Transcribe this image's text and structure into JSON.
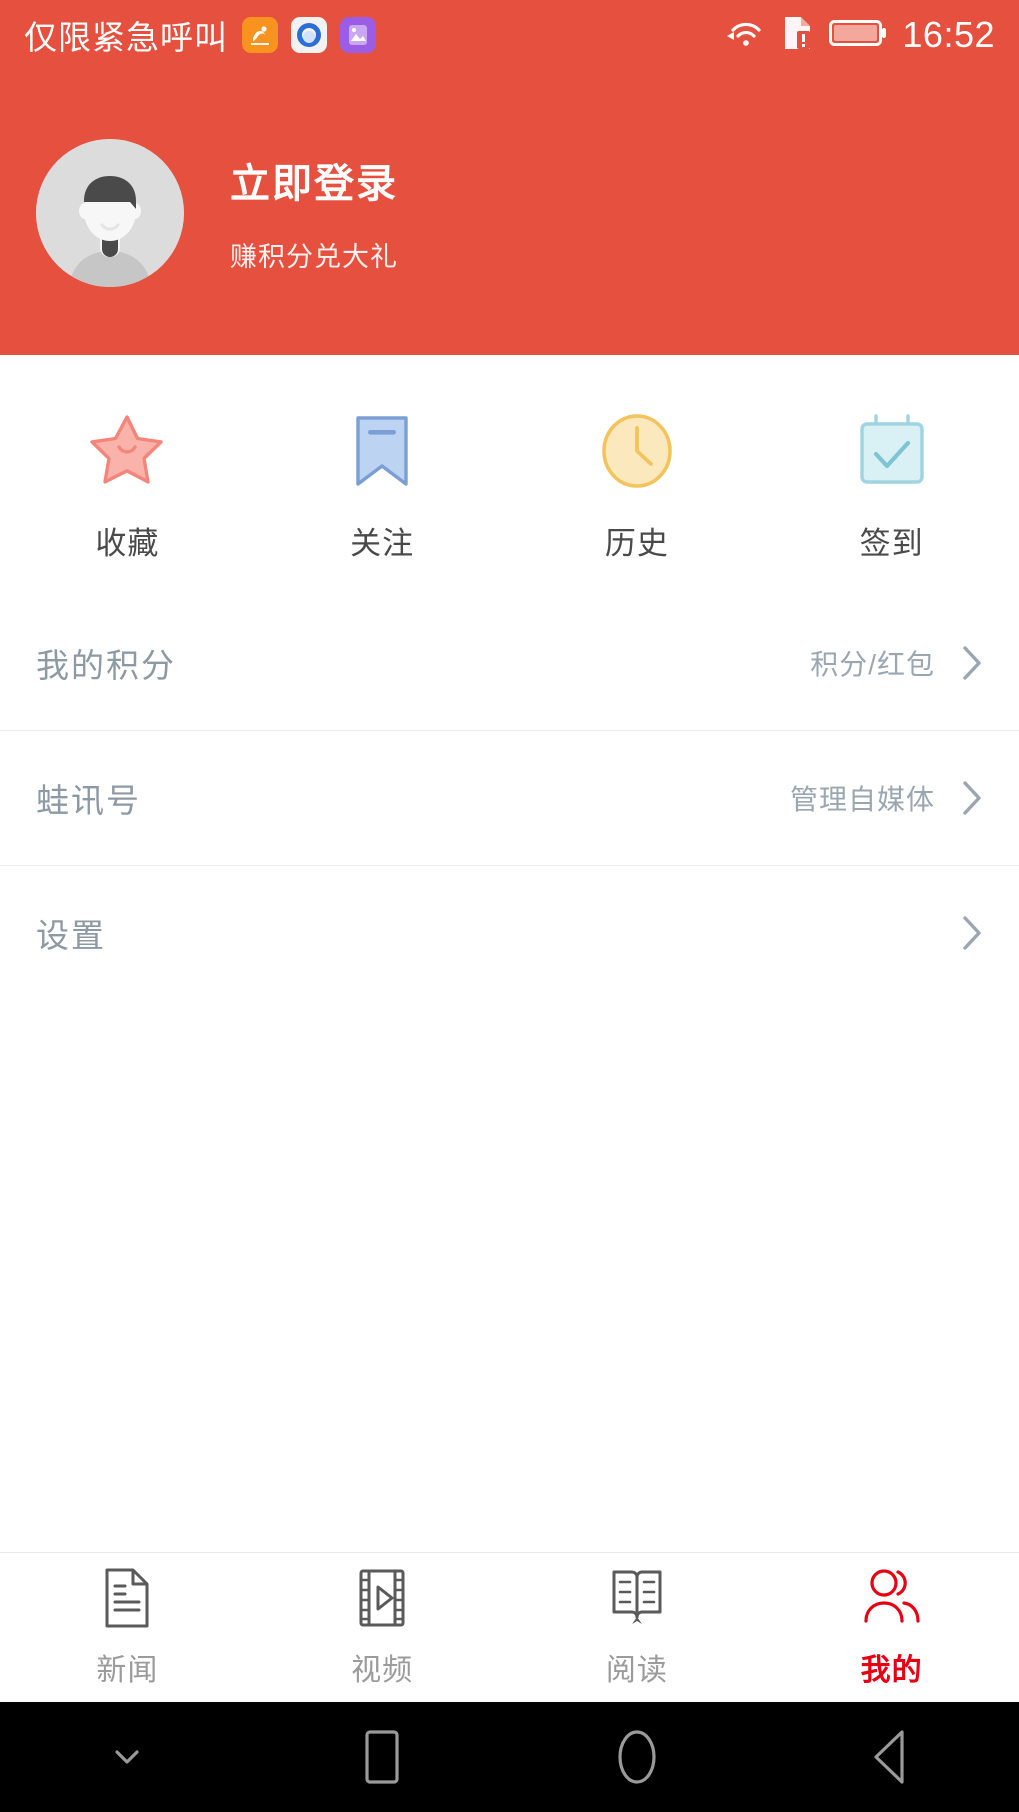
{
  "statusbar": {
    "carrier": "仅限紧急呼叫",
    "time": "16:52",
    "app_icons": [
      "uc-browser-icon",
      "qq-browser-icon",
      "photo-app-icon"
    ],
    "indicators": [
      "wifi-icon",
      "sim-alert-icon",
      "battery-icon"
    ],
    "background": "#e6503f"
  },
  "profile": {
    "avatar": "default-user-avatar",
    "name": "立即登录",
    "subtitle": "赚积分兑大礼",
    "background": "#e6503f"
  },
  "shortcuts": [
    {
      "label": "收藏",
      "icon": "star-icon",
      "color": "#f58a80"
    },
    {
      "label": "关注",
      "icon": "bookmark-icon",
      "color": "#8fafdd"
    },
    {
      "label": "历史",
      "icon": "clock-icon",
      "color": "#f5c868"
    },
    {
      "label": "签到",
      "icon": "calendar-check-icon",
      "color": "#a8d8e2"
    }
  ],
  "rows": [
    {
      "title": "我的积分",
      "value": "积分/红包",
      "chevron": "chevron-right-icon"
    },
    {
      "title": "蛙讯号",
      "value": "管理自媒体",
      "chevron": "chevron-right-icon"
    },
    {
      "title": "设置",
      "value": "",
      "chevron": "chevron-right-icon"
    }
  ],
  "tabs": [
    {
      "label": "新闻",
      "icon": "document-icon",
      "active": false
    },
    {
      "label": "视频",
      "icon": "film-play-icon",
      "active": false
    },
    {
      "label": "阅读",
      "icon": "open-book-icon",
      "active": false
    },
    {
      "label": "我的",
      "icon": "people-icon",
      "active": true
    }
  ],
  "navbar": {
    "buttons": [
      "chevron-down-icon",
      "recents-square-icon",
      "home-circle-icon",
      "back-triangle-icon"
    ]
  },
  "colors": {
    "brand_red": "#e6503f",
    "active_tab": "#e60012",
    "row_text": "#8d9aa4",
    "page_bg": "#ffffff"
  }
}
